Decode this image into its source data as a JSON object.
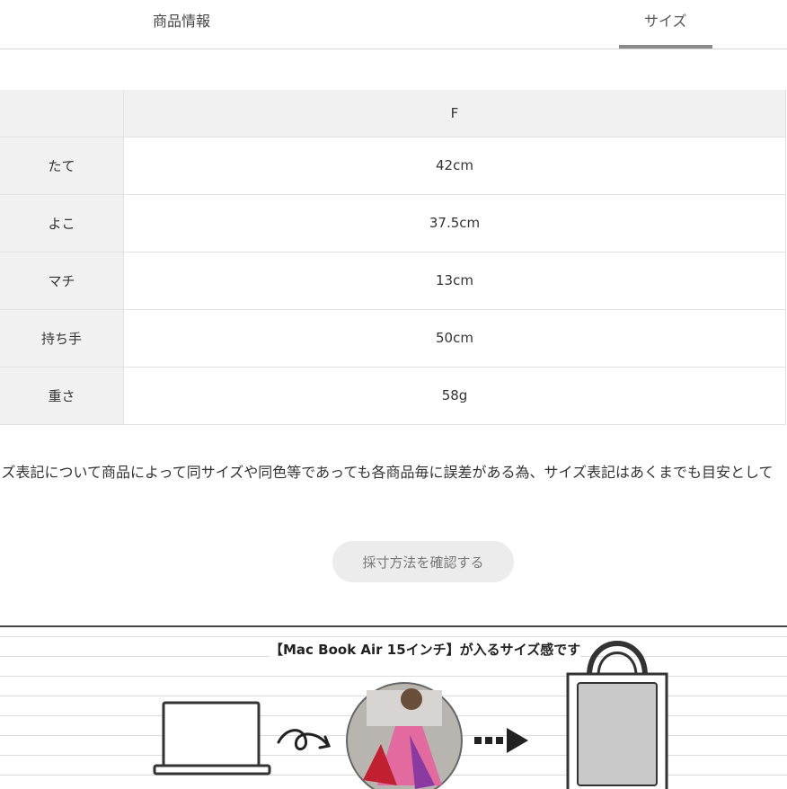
{
  "tabs": [
    {
      "label": "商品情報",
      "active": false
    },
    {
      "label": "サイズ",
      "active": true
    }
  ],
  "size_table": {
    "header": "F",
    "rows": [
      {
        "label": "たて",
        "value": "42cm"
      },
      {
        "label": "よこ",
        "value": "37.5cm"
      },
      {
        "label": "マチ",
        "value": "13cm"
      },
      {
        "label": "持ち手",
        "value": "50cm"
      },
      {
        "label": "重さ",
        "value": "58g"
      }
    ]
  },
  "note": "イズ表記について商品によって同サイズや同色等であっても各商品毎に誤差がある為、サイズ表記はあくまでも目安として",
  "measure_button": "採寸方法を確認する",
  "banner": {
    "title": "【Mac Book Air 15インチ】が入るサイズ感です",
    "icons": [
      "laptop-icon",
      "curly-arrow-icon",
      "product-photo",
      "dotted-arrow-icon",
      "tote-bag-icon"
    ]
  }
}
